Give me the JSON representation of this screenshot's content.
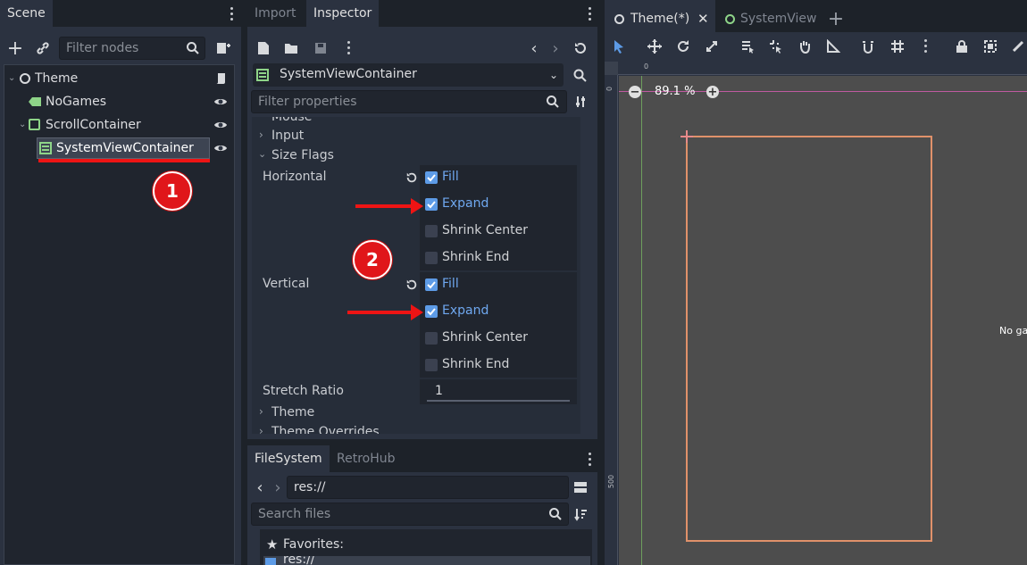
{
  "scene": {
    "tab": "Scene",
    "filter_placeholder": "Filter nodes",
    "tree": [
      {
        "label": "Theme"
      },
      {
        "label": "NoGames"
      },
      {
        "label": "ScrollContainer"
      },
      {
        "label": "SystemViewContainer"
      }
    ]
  },
  "inspector": {
    "tabs": [
      "Import",
      "Inspector"
    ],
    "node_name": "SystemViewContainer",
    "filter_placeholder": "Filter properties",
    "sections": {
      "mouse": "Mouse",
      "input": "Input",
      "size_flags": "Size Flags",
      "theme": "Theme",
      "theme_overrides": "Theme Overrides"
    },
    "horizontal": {
      "label": "Horizontal",
      "flags": [
        {
          "label": "Fill",
          "checked": true
        },
        {
          "label": "Expand",
          "checked": true
        },
        {
          "label": "Shrink Center",
          "checked": false
        },
        {
          "label": "Shrink End",
          "checked": false
        }
      ]
    },
    "vertical": {
      "label": "Vertical",
      "flags": [
        {
          "label": "Fill",
          "checked": true
        },
        {
          "label": "Expand",
          "checked": true
        },
        {
          "label": "Shrink Center",
          "checked": false
        },
        {
          "label": "Shrink End",
          "checked": false
        }
      ]
    },
    "stretch_ratio": {
      "label": "Stretch Ratio",
      "value": "1"
    }
  },
  "filesystem": {
    "tabs": [
      "FileSystem",
      "RetroHub"
    ],
    "path": "res://",
    "search_placeholder": "Search files",
    "favorites": "Favorites:",
    "partial_item": "res://"
  },
  "viewport": {
    "tabs": [
      "Theme(*)",
      "SystemView"
    ],
    "zoom": "89.1 %",
    "ruler_zero": "0",
    "ruler_left_zero": "0",
    "ruler_500": "500",
    "clipped_text": "No ga"
  },
  "annotations": {
    "step1": "1",
    "step2": "2"
  },
  "colors": {
    "accent": "#5d9be6",
    "selection_outline": "#e0916a",
    "annotation_red": "#ee1414",
    "script_green": "#8ed488"
  }
}
